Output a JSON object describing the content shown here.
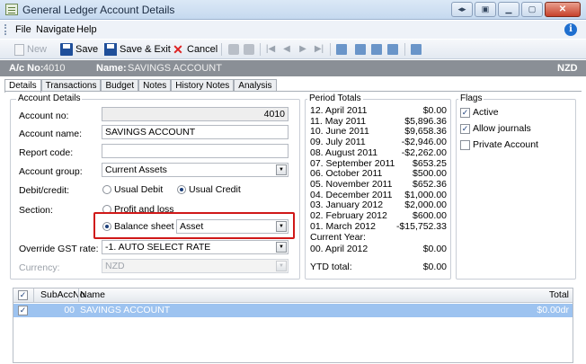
{
  "window": {
    "title": "General Ledger Account Details"
  },
  "menu": {
    "items": [
      "File",
      "Navigate",
      "Help"
    ]
  },
  "toolbar": {
    "new": "New",
    "save": "Save",
    "save_exit": "Save & Exit",
    "cancel": "Cancel"
  },
  "header": {
    "ac_label": "A/c No:",
    "ac_value": "4010",
    "name_label": "Name:",
    "name_value": "SAVINGS ACCOUNT",
    "currency": "NZD"
  },
  "tabs": [
    "Details",
    "Transactions",
    "Budget",
    "Notes",
    "History Notes",
    "Analysis"
  ],
  "account_details": {
    "title": "Account Details",
    "account_no_label": "Account no:",
    "account_no": "4010",
    "account_name_label": "Account name:",
    "account_name": "SAVINGS ACCOUNT",
    "report_code_label": "Report code:",
    "report_code": "",
    "account_group_label": "Account group:",
    "account_group": "Current Assets",
    "debit_credit_label": "Debit/credit:",
    "usual_debit": "Usual Debit",
    "usual_credit": "Usual Credit",
    "section_label": "Section:",
    "profit_loss": "Profit and loss",
    "balance_sheet": "Balance sheet",
    "balance_sheet_type": "Asset",
    "override_gst_label": "Override GST rate:",
    "override_gst": "-1. AUTO SELECT RATE",
    "currency_label": "Currency:",
    "currency": "NZD"
  },
  "period_totals": {
    "title": "Period Totals",
    "rows": [
      {
        "period": "12. April 2011",
        "amount": "$0.00"
      },
      {
        "period": "11. May 2011",
        "amount": "$5,896.36"
      },
      {
        "period": "10. June 2011",
        "amount": "$9,658.36"
      },
      {
        "period": "09. July 2011",
        "amount": "-$2,946.00"
      },
      {
        "period": "08. August 2011",
        "amount": "-$2,262.00"
      },
      {
        "period": "07. September 2011",
        "amount": "$653.25"
      },
      {
        "period": "06. October 2011",
        "amount": "$500.00"
      },
      {
        "period": "05. November 2011",
        "amount": "$652.36"
      },
      {
        "period": "04. December 2011",
        "amount": "$1,000.00"
      },
      {
        "period": "03. January 2012",
        "amount": "$2,000.00"
      },
      {
        "period": "02. February 2012",
        "amount": "$600.00"
      },
      {
        "period": "01. March 2012",
        "amount": "-$15,752.33"
      }
    ],
    "current_year_label": "Current Year:",
    "current_row": {
      "period": "00. April 2012",
      "amount": "$0.00"
    },
    "ytd_label": "YTD total:",
    "ytd_value": "$0.00"
  },
  "flags": {
    "title": "Flags",
    "active": "Active",
    "allow_journals": "Allow journals",
    "private_account": "Private Account"
  },
  "subaccounts": {
    "headers": {
      "subaccno": "SubAccNo",
      "name": "Name",
      "total": "Total"
    },
    "rows": [
      {
        "subaccno": "00",
        "name": "SAVINGS ACCOUNT",
        "total": "$0.00dr"
      }
    ]
  }
}
